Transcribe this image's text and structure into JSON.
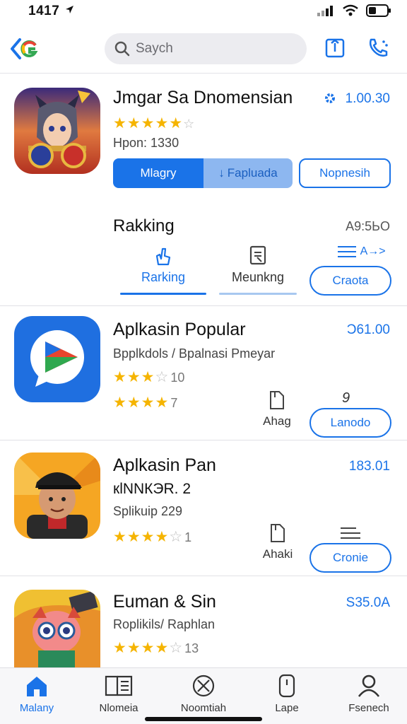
{
  "status": {
    "time": "1417"
  },
  "search": {
    "placeholder": "Saych"
  },
  "featured": {
    "title": "Jmgar Sa Dnomensian",
    "price": "1.00.30",
    "stars": "★★★★★",
    "subtitle": "Hpon: 1330",
    "primary_label": "Mlagry",
    "secondary_label": "Fapluada",
    "outline_label": "Nopnesih"
  },
  "ranking": {
    "title": "Rakking",
    "right_label": "A9:5ЬO",
    "tabs": [
      {
        "label": "Rarking",
        "icon": "touch-icon"
      },
      {
        "label": "Meunkng",
        "icon": "document-icon"
      }
    ],
    "list_icon_text": "A→>",
    "button_label": "Craota"
  },
  "apps": [
    {
      "title": "Aplkasin Popular",
      "price": "Ͻ61.00",
      "subtitle": "Bpplkdols / Bpalnasi Pmeyar",
      "stars_1": "★★★",
      "stars_1_empty": "☆",
      "count_1": "10",
      "stars_2": "★★★★",
      "count_2": "7",
      "action_label": "Ahag",
      "action_num": "9",
      "button_label": "Lanodo"
    },
    {
      "title": "Aplkasin Pan",
      "price": "183.01",
      "subtitle": "кlNNКЭR. 2",
      "subtitle2": "Splikuip 229",
      "stars": "★★★★",
      "stars_empty": "☆",
      "count": "1",
      "action_label": "Ahaki",
      "button_label": "Cronie"
    },
    {
      "title": "Euman & Sin",
      "price": "Ѕ35.0A",
      "subtitle": "Roplikils/ Raphlan",
      "stars": "★★★★",
      "stars_empty": "☆",
      "count": "13"
    }
  ],
  "tabbar": {
    "items": [
      {
        "label": "Malany",
        "icon": "home-icon"
      },
      {
        "label": "Nlomeia",
        "icon": "news-icon"
      },
      {
        "label": "Noomtiah",
        "icon": "explore-icon"
      },
      {
        "label": "Lape",
        "icon": "phone-icon"
      },
      {
        "label": "Fsenech",
        "icon": "profile-icon"
      }
    ]
  },
  "colors": {
    "accent": "#1a73e8",
    "star": "#f5b400"
  }
}
